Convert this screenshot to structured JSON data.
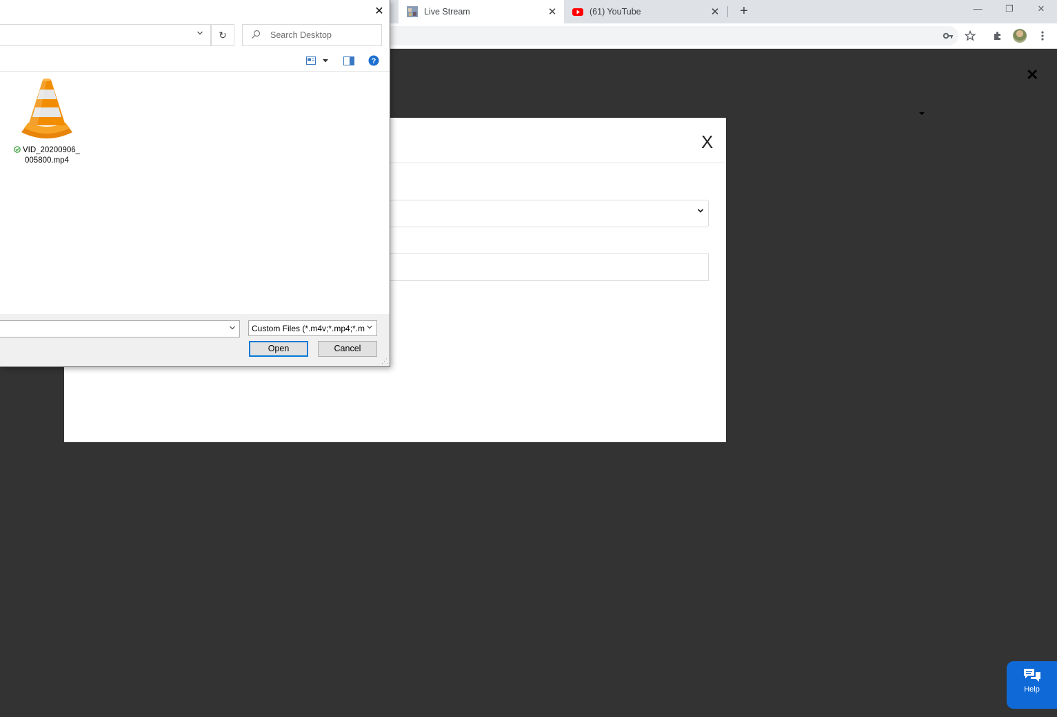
{
  "browser": {
    "tabs": [
      {
        "title": "Live Stream",
        "active": true,
        "close": "✕"
      },
      {
        "title": "(61) YouTube",
        "active": false,
        "close": "✕"
      }
    ],
    "new_tab": "+",
    "window_controls": {
      "minimize": "—",
      "restore": "❐",
      "close": "✕"
    },
    "toolbar_icons": [
      "key-icon",
      "star-icon",
      "extensions-icon",
      "avatar",
      "menu-icon"
    ]
  },
  "page": {
    "close_glyph": "✕",
    "modal": {
      "close_label": "X",
      "select_chevron": "⌄"
    },
    "help": {
      "label": "Help"
    }
  },
  "dialog": {
    "close_glyph": "✕",
    "address_chevron": "⌄",
    "refresh_glyph": "↻",
    "search_placeholder": "Search Desktop",
    "files": [
      {
        "name_line1": "VID_20200906_",
        "name_line2": "005800.mp4",
        "icon": "vlc-cone-icon",
        "status": "synced"
      }
    ],
    "filename_value": "",
    "filter_value": "Custom Files (*.m4v;*.mp4;*.m",
    "open_label": "Open",
    "cancel_label": "Cancel"
  },
  "colors": {
    "page_bg": "#333333",
    "accent": "#0078d7",
    "help_bg": "#0f6ad8",
    "youtube_red": "#ff0000",
    "vlc_orange": "#f28c00"
  }
}
